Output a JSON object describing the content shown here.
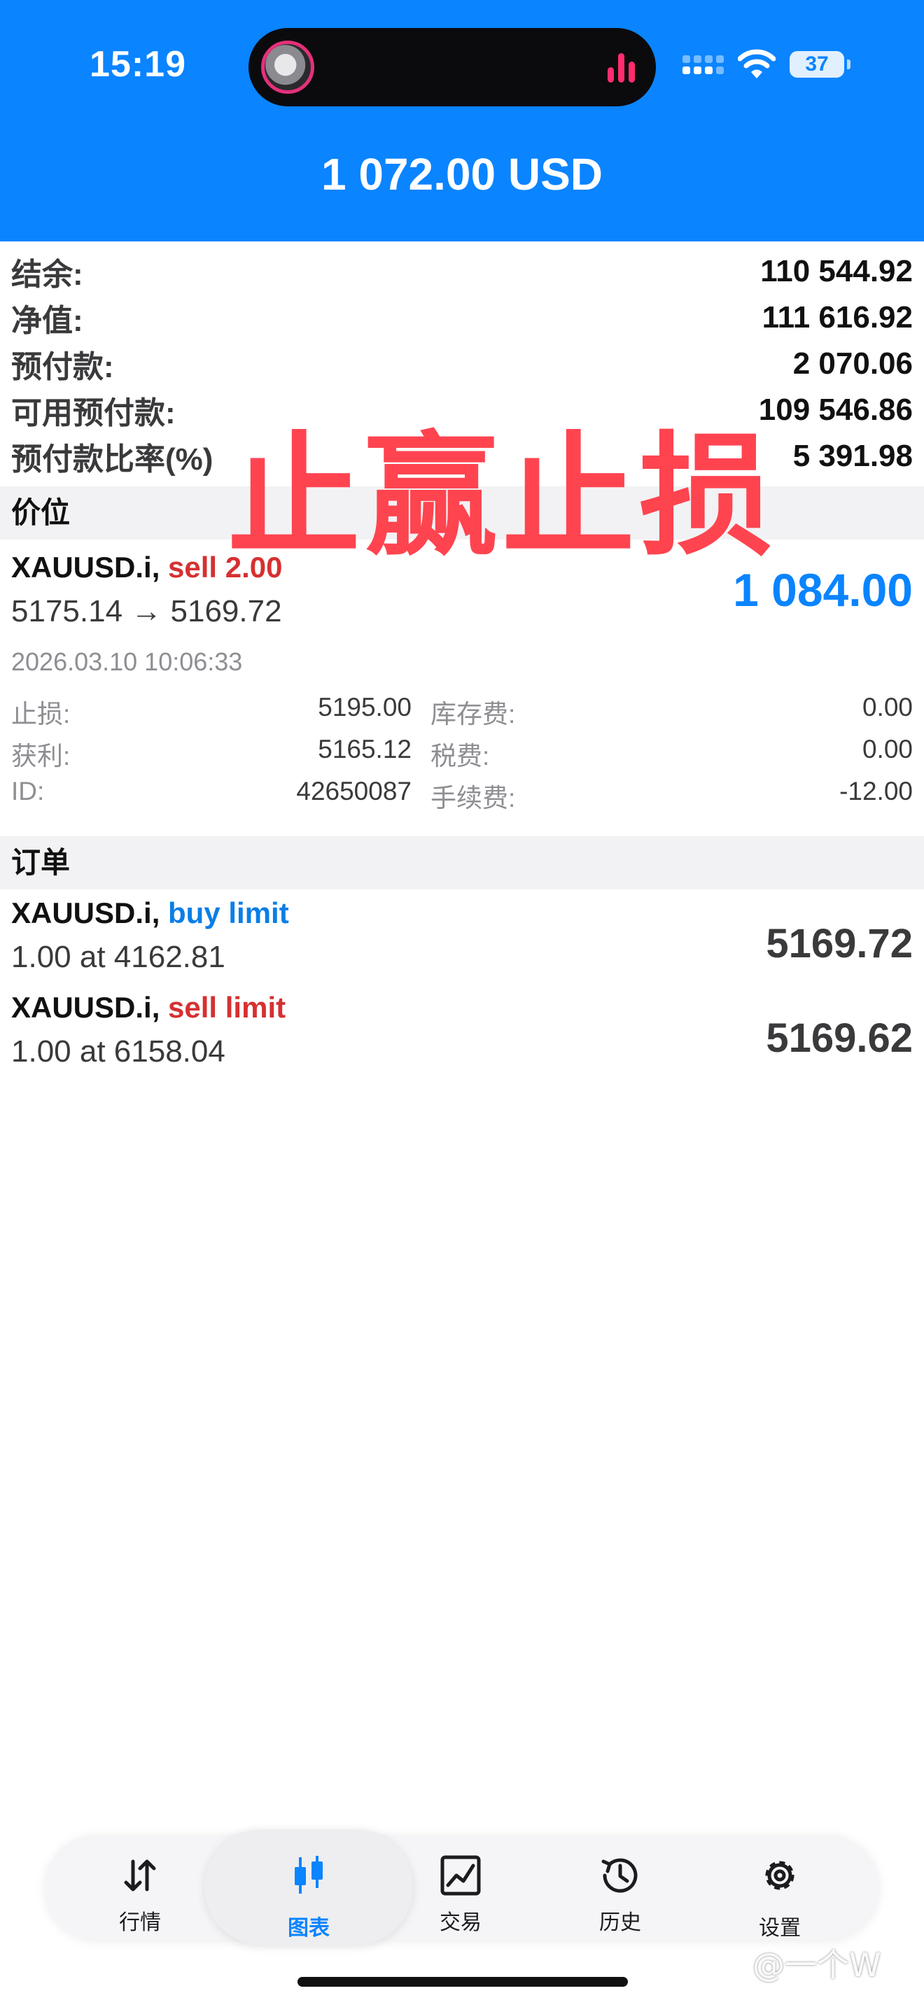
{
  "status_bar": {
    "time": "15:19",
    "battery": "37"
  },
  "header": {
    "title": "1 072.00 USD"
  },
  "summary": [
    {
      "label": "结余:",
      "value": "110 544.92"
    },
    {
      "label": "净值:",
      "value": "111 616.92"
    },
    {
      "label": "预付款:",
      "value": "2 070.06"
    },
    {
      "label": "可用预付款:",
      "value": "109 546.86"
    },
    {
      "label": "预付款比率(%)",
      "value": "5 391.98"
    }
  ],
  "overlay_text": "止赢止损",
  "positions_section": {
    "title": "价位"
  },
  "position": {
    "symbol": "XAUUSD.i,",
    "side": "sell 2.00",
    "price_change": "5175.14 → 5169.72",
    "profit": "1 084.00",
    "datetime": "2026.03.10 10:06:33",
    "details": {
      "sl_label": "止损:",
      "sl_value": "5195.00",
      "tp_label": "获利:",
      "tp_value": "5165.12",
      "id_label": "ID:",
      "id_value": "42650087",
      "swap_label": "库存费:",
      "swap_value": "0.00",
      "tax_label": "税费:",
      "tax_value": "0.00",
      "commission_label": "手续费:",
      "commission_value": "-12.00"
    }
  },
  "orders_section": {
    "title": "订单"
  },
  "orders": [
    {
      "symbol": "XAUUSD.i,",
      "type": "buy limit",
      "detail": "1.00 at 4162.81",
      "price": "5169.72"
    },
    {
      "symbol": "XAUUSD.i,",
      "type": "sell limit",
      "detail": "1.00 at 6158.04",
      "price": "5169.62"
    }
  ],
  "tabs": [
    {
      "label": "行情",
      "icon": "quotes-arrows-icon"
    },
    {
      "label": "图表",
      "icon": "chart-candles-icon",
      "active": true
    },
    {
      "label": "交易",
      "icon": "trade-chart-icon"
    },
    {
      "label": "历史",
      "icon": "history-clock-icon"
    },
    {
      "label": "设置",
      "icon": "settings-gear-icon"
    }
  ],
  "watermark": "@一个W",
  "colors": {
    "header_blue": "#0a84ff",
    "sell_red": "#d63031",
    "buy_blue": "#0a7ee6",
    "stamp_red": "#ff3b47"
  }
}
